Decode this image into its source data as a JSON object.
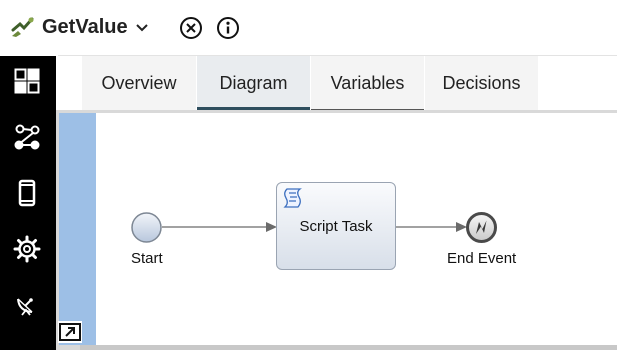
{
  "header": {
    "title": "GetValue",
    "icons": [
      "app-logo-icon",
      "chevron-down-icon",
      "close-circle-icon",
      "info-icon"
    ]
  },
  "sidebar": {
    "items": [
      {
        "icon": "dashboard-icon"
      },
      {
        "icon": "flow-icon"
      },
      {
        "icon": "mobile-icon"
      },
      {
        "icon": "gear-icon"
      },
      {
        "icon": "satellite-dish-icon"
      }
    ]
  },
  "tabs": [
    {
      "label": "Overview",
      "active": false
    },
    {
      "label": "Diagram",
      "active": true
    },
    {
      "label": "Variables",
      "active": false
    },
    {
      "label": "Decisions",
      "active": false
    }
  ],
  "diagram": {
    "start_label": "Start",
    "task_label": "Script Task",
    "end_label": "End Event"
  },
  "colors": {
    "sidebar": "#000000",
    "tab_active_underline": "#2e4e5e",
    "lane": "#9dbfe6",
    "task_border": "#9aa4b2",
    "connector": "#6b6b6b"
  }
}
